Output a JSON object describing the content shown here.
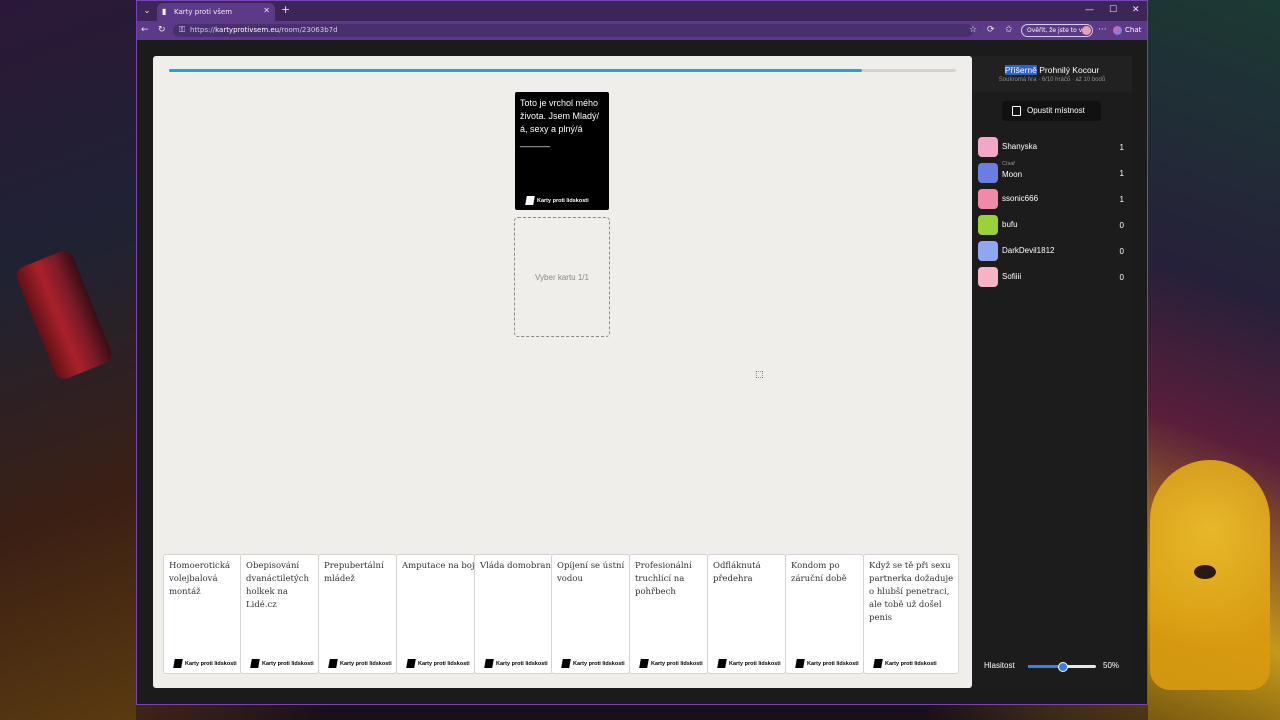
{
  "browser": {
    "tab_title": "Karty proti všem",
    "url_prefix": "https://",
    "url_domain": "kartyprotivsem.eu",
    "url_path": "/room/23063b7d",
    "verify_label": "Ověřit, že jste to vy",
    "chat_label": "Chat",
    "accent_color": "#5c3a87"
  },
  "game": {
    "progress_fraction": 0.88,
    "black_card_text": "Toto je vrchol mého života. Jsem Mladý/á, sexy a plný/á ______",
    "card_brand": "Karty proti lidskosti",
    "slot_label": "Vyber kartu 1/1",
    "hand": [
      {
        "text": "Homoerotická volejbalová montáž"
      },
      {
        "text": "Obepisování dvanáctiletých holkek na Lidé.cz"
      },
      {
        "text": "Prepubertální mládež"
      },
      {
        "text": "Amputace na bojišti"
      },
      {
        "text": "Vláda domobrany"
      },
      {
        "text": "Opíjení se ústní vodou"
      },
      {
        "text": "Profesionální truchlící na pohřbech"
      },
      {
        "text": "Odfláknutá předehra"
      },
      {
        "text": "Kondom po záruční době"
      },
      {
        "text": "Když se tě při sexu partnerka dožaduje o hlubší penetraci, ale tobě už došel penis"
      }
    ]
  },
  "sidebar": {
    "room_title_highlight": "Příšerně",
    "room_title_rest": " Prohnilý Kocour",
    "room_info": "Soukromá hra · 6/10 hráčů · až 10 bodů",
    "leave_label": "Opustit místnost",
    "czar_label": "Císař",
    "players": [
      {
        "name": "Shanyska",
        "score": "1",
        "color": "#f2a7c9",
        "czar": false
      },
      {
        "name": "Moon",
        "score": "1",
        "color": "#6a7de0",
        "czar": true
      },
      {
        "name": "ssonic666",
        "score": "1",
        "color": "#f08aa8",
        "czar": false
      },
      {
        "name": "bufu",
        "score": "0",
        "color": "#9bd23a",
        "czar": false
      },
      {
        "name": "DarkDevil1812",
        "score": "0",
        "color": "#8fa6f0",
        "czar": false
      },
      {
        "name": "Sofiiii",
        "score": "0",
        "color": "#f5b3c3",
        "czar": false
      }
    ],
    "volume_label": "Hlasitost",
    "volume_fraction": 0.5,
    "volume_value": "50%"
  }
}
